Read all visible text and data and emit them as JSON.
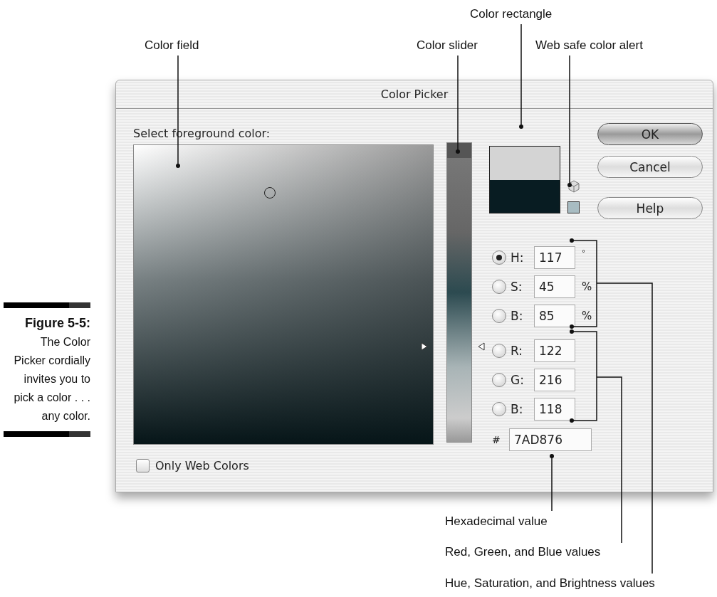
{
  "callouts": [
    {
      "text": "Color rectangle"
    },
    {
      "text": "Color field"
    },
    {
      "text": "Color slider"
    },
    {
      "text": "Web safe color alert"
    },
    {
      "text": "Hexadecimal value"
    },
    {
      "text": "Red, Green, and Blue values"
    },
    {
      "text": "Hue, Saturation, and Brightness values"
    }
  ],
  "caption": {
    "label": "Figure 5-5:",
    "text": "The Color Picker cordially invites you to pick a color . . . any color."
  },
  "window": {
    "title": "Color Picker"
  },
  "prompt": "Select foreground color:",
  "slider": {
    "level": 0.32
  },
  "buttons": [
    {
      "label": "OK",
      "default": true
    },
    {
      "label": "Cancel",
      "default": false
    },
    {
      "label": "Help",
      "default": false
    }
  ],
  "fields": [
    {
      "label": "H:",
      "value": "117",
      "unit": "°",
      "selected": true
    },
    {
      "label": "S:",
      "value": "45",
      "unit": "%",
      "selected": false
    },
    {
      "label": "B:",
      "value": "85",
      "unit": "%",
      "selected": false
    },
    {
      "label": "R:",
      "value": "122",
      "selected": false
    },
    {
      "label": "G:",
      "value": "216",
      "selected": false
    },
    {
      "label": "B:",
      "value": "118",
      "selected": false
    }
  ],
  "hex": {
    "label": "#",
    "value": "7AD876"
  },
  "only_web_colors": {
    "label": "Only Web Colors",
    "checked": false
  }
}
